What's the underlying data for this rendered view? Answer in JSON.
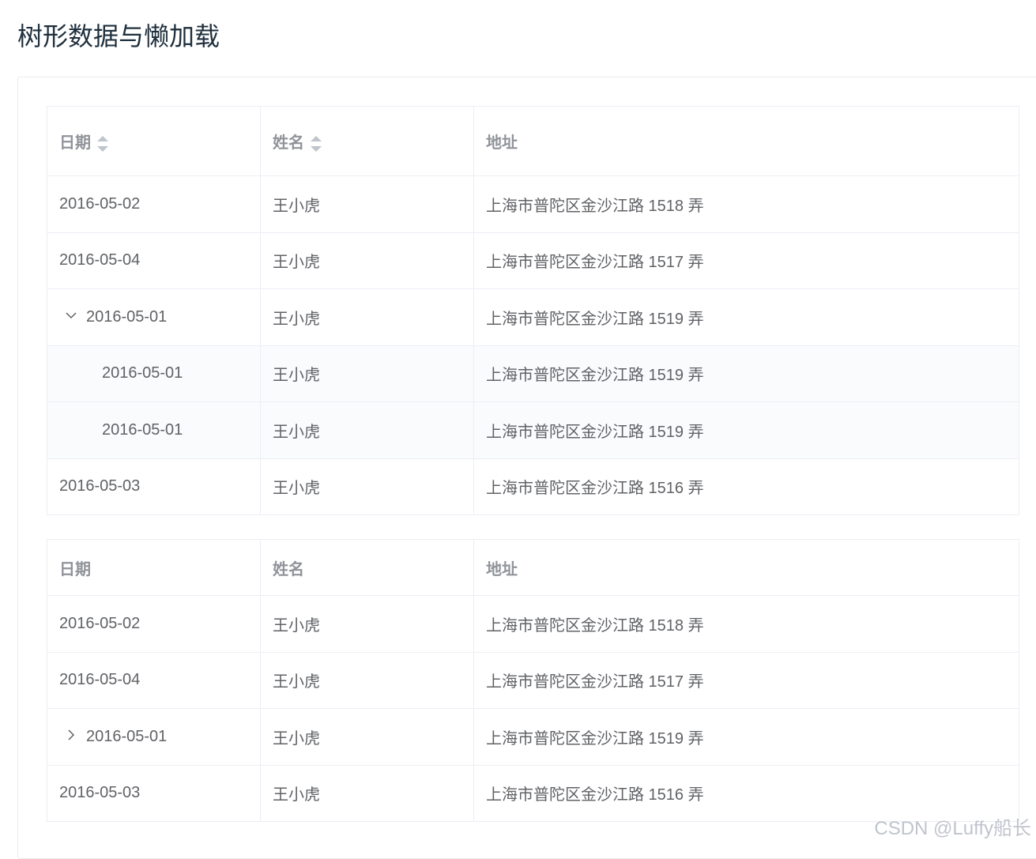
{
  "page": {
    "title": "树形数据与懒加载"
  },
  "tree_table": {
    "headers": {
      "date": "日期",
      "name": "姓名",
      "address": "地址"
    },
    "rows": [
      {
        "date": "2016-05-02",
        "name": "王小虎",
        "address": "上海市普陀区金沙江路 1518 弄"
      },
      {
        "date": "2016-05-04",
        "name": "王小虎",
        "address": "上海市普陀区金沙江路 1517 弄"
      },
      {
        "date": "2016-05-01",
        "name": "王小虎",
        "address": "上海市普陀区金沙江路 1519 弄"
      },
      {
        "date": "2016-05-01",
        "name": "王小虎",
        "address": "上海市普陀区金沙江路 1519 弄"
      },
      {
        "date": "2016-05-01",
        "name": "王小虎",
        "address": "上海市普陀区金沙江路 1519 弄"
      },
      {
        "date": "2016-05-03",
        "name": "王小虎",
        "address": "上海市普陀区金沙江路 1516 弄"
      }
    ]
  },
  "lazy_table": {
    "headers": {
      "date": "日期",
      "name": "姓名",
      "address": "地址"
    },
    "rows": [
      {
        "date": "2016-05-02",
        "name": "王小虎",
        "address": "上海市普陀区金沙江路 1518 弄"
      },
      {
        "date": "2016-05-04",
        "name": "王小虎",
        "address": "上海市普陀区金沙江路 1517 弄"
      },
      {
        "date": "2016-05-01",
        "name": "王小虎",
        "address": "上海市普陀区金沙江路 1519 弄"
      },
      {
        "date": "2016-05-03",
        "name": "王小虎",
        "address": "上海市普陀区金沙江路 1516 弄"
      }
    ]
  },
  "icons": {
    "expanded": "chevron-down-icon",
    "collapsed": "chevron-right-icon",
    "sort": "sort-caret-icon"
  },
  "watermark": "CSDN @Luffy船长"
}
